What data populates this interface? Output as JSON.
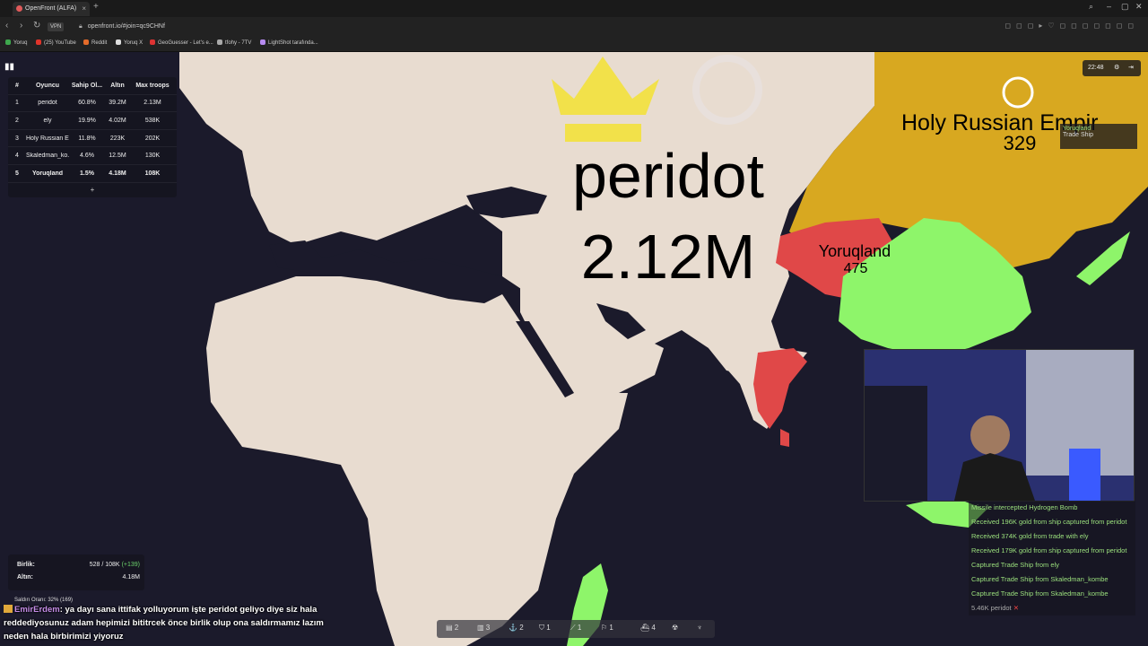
{
  "browser": {
    "tab_title": "OpenFront (ALFA)",
    "url": "openfront.io/#join=qc9CHNf",
    "vpn_label": "VPN",
    "bookmarks": [
      "Yoruq",
      "(25) YouTube",
      "Reddit",
      "Yoruq X",
      "GeoGuesser - Let's e...",
      "tfohy - 7TV",
      "LightShot tarafında..."
    ],
    "bookmark_colors": [
      "#3ea84d",
      "#e0342a",
      "#e46b2a",
      "#ddd",
      "#d33",
      "#aaa",
      "#b68bf0"
    ]
  },
  "leaderboard": {
    "headers": [
      "#",
      "Oyuncu",
      "Sahip Ol...",
      "Altın",
      "Max troops"
    ],
    "rows": [
      {
        "rank": "1",
        "name": "peridot",
        "owned": "60.8%",
        "gold": "39.2M",
        "troops": "2.13M"
      },
      {
        "rank": "2",
        "name": "ely",
        "owned": "19.9%",
        "gold": "4.02M",
        "troops": "538K"
      },
      {
        "rank": "3",
        "name": "Holy Russian E...",
        "owned": "11.8%",
        "gold": "223K",
        "troops": "202K"
      },
      {
        "rank": "4",
        "name": "Skaledman_ko...",
        "owned": "4.6%",
        "gold": "12.5M",
        "troops": "130K"
      },
      {
        "rank": "5",
        "name": "Yoruqland",
        "owned": "1.5%",
        "gold": "4.18M",
        "troops": "108K"
      }
    ],
    "more": "+"
  },
  "timer": "22:48",
  "map": {
    "big_name": "peridot",
    "big_value": "2.12M",
    "hre_name": "Holy Russian Empir",
    "hre_troops": "329",
    "yoruq_name": "Yoruqland",
    "yoruq_troops": "475"
  },
  "tooltip": {
    "name": "Yoruqland",
    "sub": "Trade Ship"
  },
  "messages": [
    "Missile intercepted Hydrogen Bomb",
    "Received 196K gold from ship captured from peridot",
    "Received 374K gold from trade with ely",
    "Received 179K gold from ship captured from peridot",
    "Captured Trade Ship from ely",
    "Captured Trade Ship from Skaledman_kombe",
    "Captured Trade Ship from Skaledman_kombe",
    "5.46K peridot"
  ],
  "unit_panel": {
    "troops_label": "Birlik:",
    "troops_value": "528 / 108K",
    "troops_gain": "(+139)",
    "gold_label": "Altın:",
    "gold_value": "4.18M"
  },
  "attack_ratio": "Saldırı Oranı: 32% (169)",
  "chat": {
    "user": "EmirErdem",
    "text": ": ya dayı sana ittifak yolluyorum işte peridot geliyo diye siz hala reddediyosunuz adam hepimizi bititrcek önce birlik olup ona saldırmamız lazım neden hala birbirimizi yiyoruz"
  },
  "bottom_bar": [
    "2",
    "3",
    "2",
    "1",
    "1",
    "1",
    "4"
  ],
  "colors": {
    "ocean": "#1b1a2b",
    "land": "#e8dcd0",
    "hre": "#d8a820",
    "yoruq": "#e04848",
    "ely": "#8ef56a",
    "crown": "#f2e14a"
  }
}
